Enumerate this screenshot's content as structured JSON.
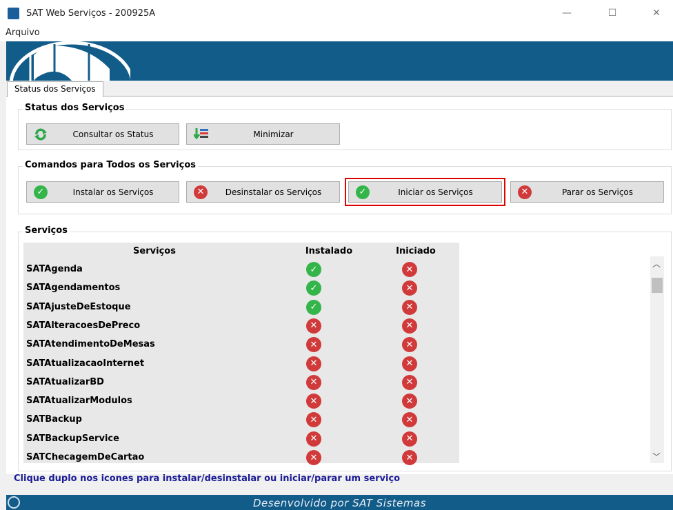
{
  "window": {
    "title": "SAT Web Serviços - 200925A"
  },
  "menu": {
    "items": [
      "Arquivo"
    ]
  },
  "tabs": [
    {
      "label": "Status dos Serviços"
    }
  ],
  "status_group": {
    "title": "Status dos Serviços",
    "buttons": [
      {
        "label": "Consultar os Status",
        "icon": "refresh-icon"
      },
      {
        "label": "Minimizar",
        "icon": "minimize-app-icon"
      }
    ]
  },
  "commands_group": {
    "title": "Comandos para Todos os Serviços",
    "buttons": [
      {
        "label": "Instalar os Serviços",
        "icon": "check-icon"
      },
      {
        "label": "Desinstalar os Serviços",
        "icon": "x-icon"
      },
      {
        "label": "Iniciar os Serviços",
        "icon": "check-icon"
      },
      {
        "label": "Parar os Serviços",
        "icon": "x-icon"
      }
    ]
  },
  "services_group": {
    "title": "Serviços",
    "columns": [
      "Serviços",
      "Instalado",
      "Iniciado"
    ],
    "rows": [
      {
        "name": "SATAgenda",
        "installed": true,
        "started": false
      },
      {
        "name": "SATAgendamentos",
        "installed": true,
        "started": false
      },
      {
        "name": "SATAjusteDeEstoque",
        "installed": true,
        "started": false
      },
      {
        "name": "SATAlteracoesDePreco",
        "installed": false,
        "started": false
      },
      {
        "name": "SATAtendimentoDeMesas",
        "installed": false,
        "started": false
      },
      {
        "name": "SATAtualizacaoInternet",
        "installed": false,
        "started": false
      },
      {
        "name": "SATAtualizarBD",
        "installed": false,
        "started": false
      },
      {
        "name": "SATAtualizarModulos",
        "installed": false,
        "started": false
      },
      {
        "name": "SATBackup",
        "installed": false,
        "started": false
      },
      {
        "name": "SATBackupService",
        "installed": false,
        "started": false
      },
      {
        "name": "SATChecagemDeCartao",
        "installed": false,
        "started": false
      }
    ]
  },
  "hint": "Clique duplo nos icones para instalar/desinstalar ou iniciar/parar um serviço",
  "footer": "Desenvolvido por SAT Sistemas",
  "colors": {
    "banner": "#125c8a",
    "ok": "#33b54a",
    "fail": "#d13a3a",
    "highlight": "#e00000"
  }
}
